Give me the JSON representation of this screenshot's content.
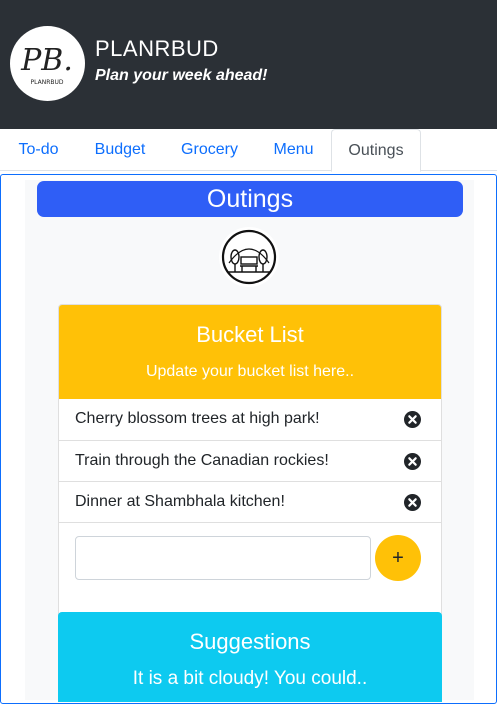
{
  "header": {
    "logo_text": "PB.",
    "logo_subtext": "PLANRBUD",
    "brand": "PLANRBUD",
    "tagline": "Plan your week ahead!"
  },
  "tabs": [
    {
      "label": "To-do",
      "active": false
    },
    {
      "label": "Budget",
      "active": false
    },
    {
      "label": "Grocery",
      "active": false
    },
    {
      "label": "Menu",
      "active": false
    },
    {
      "label": "Outings",
      "active": true
    }
  ],
  "outings": {
    "title": "Outings",
    "icon": "park-bench-icon"
  },
  "bucket_list": {
    "title": "Bucket List",
    "subtitle": "Update your bucket list here..",
    "items": [
      "Cherry blossom trees at high park!",
      "Train through the Canadian rockies!",
      "Dinner at Shambhala kitchen!"
    ],
    "new_item_value": "",
    "add_label": "+"
  },
  "suggestions": {
    "title": "Suggestions",
    "subtitle": "It is a bit cloudy! You could.."
  },
  "colors": {
    "header_bg": "#2b3036",
    "accent_blue": "#2f5ef6",
    "bucket_yellow": "#ffc107",
    "suggestions_cyan": "#0dcaf0",
    "link": "#0d6efd"
  }
}
